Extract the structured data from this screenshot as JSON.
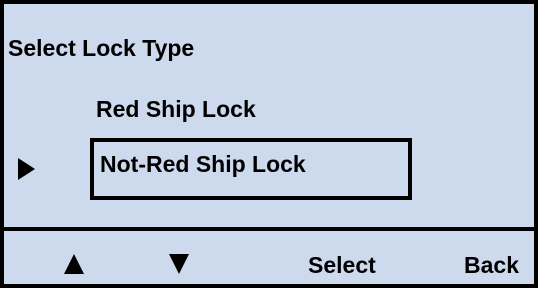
{
  "colors": {
    "screen_background": "#cdd9ec",
    "foreground": "#000000"
  },
  "screen": {
    "title": "Select Lock Type",
    "selected_index": 1,
    "items": [
      {
        "label": "Red Ship Lock"
      },
      {
        "label": "Not-Red Ship Lock"
      }
    ]
  },
  "softkeys": {
    "up_icon": "triangle-up-icon",
    "down_icon": "triangle-down-icon",
    "select_label": "Select",
    "back_label": "Back"
  }
}
